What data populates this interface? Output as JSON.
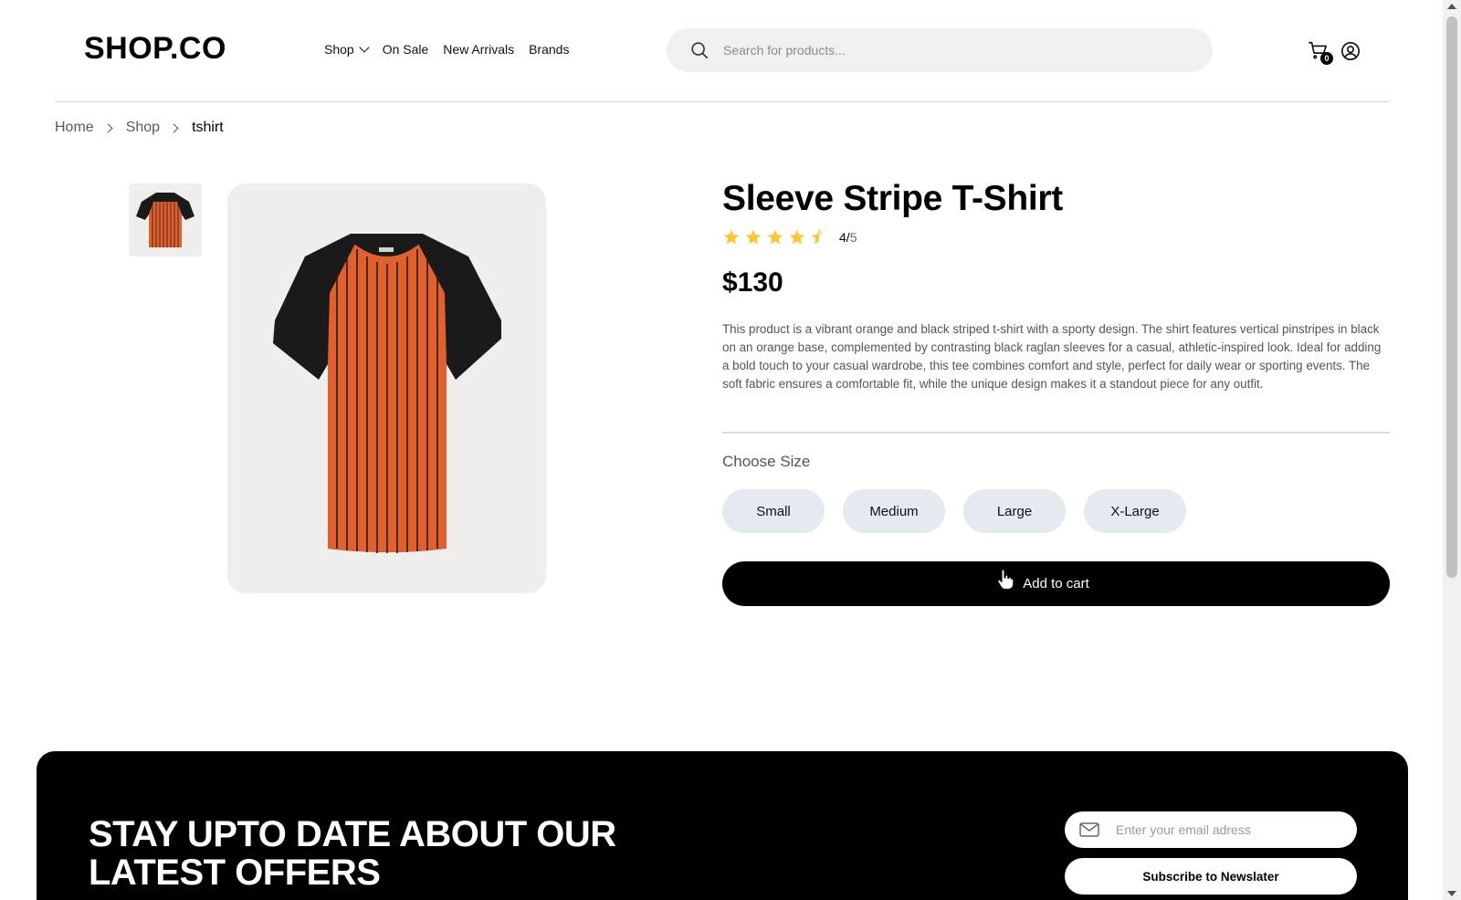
{
  "header": {
    "logo": "SHOP.CO",
    "nav": [
      {
        "label": "Shop",
        "has_dropdown": true
      },
      {
        "label": "On Sale"
      },
      {
        "label": "New Arrivals"
      },
      {
        "label": "Brands"
      }
    ],
    "search": {
      "placeholder": "Search for products...",
      "value": "",
      "icon": "search-icon"
    },
    "cart": {
      "icon": "cart-icon",
      "count": "0"
    },
    "user": {
      "icon": "user-icon"
    }
  },
  "breadcrumb": [
    "Home",
    "Shop",
    "tshirt"
  ],
  "product": {
    "title": "Sleeve Stripe T-Shirt",
    "rating": {
      "value": "4",
      "sep": "/",
      "max": "5"
    },
    "rating_score": 4.5,
    "price": "$130",
    "description": "This product is a vibrant orange and black striped t-shirt with a sporty design. The shirt features vertical pinstripes in black on an orange base, complemented by contrasting black raglan sleeves for a casual, athletic-inspired look. Ideal for adding a bold touch to your casual wardrobe, this tee combines comfort and style, perfect for daily wear or sporting events. The soft fabric ensures a comfortable fit, while the unique design makes it a standout piece for any outfit.",
    "size_label": "Choose Size",
    "sizes": [
      "Small",
      "Medium",
      "Large",
      "X-Large"
    ],
    "add_to_cart": "Add to cart",
    "colors": {
      "shirt_body": "#e0602f",
      "shirt_sleeves": "#1a1a1a",
      "stripes": "#2b1a14"
    }
  },
  "newsletter": {
    "title_line1": "STAY UPTO DATE ABOUT OUR",
    "title_line2": "LATEST OFFERS",
    "email_placeholder": "Enter your email adress",
    "email_icon": "mail-icon",
    "subscribe_label": "Subscribe to Newslater"
  },
  "colors": {
    "accent": "#000000",
    "star": "#ffc633",
    "background": "#ffffff",
    "panel": "#f0eeed"
  }
}
